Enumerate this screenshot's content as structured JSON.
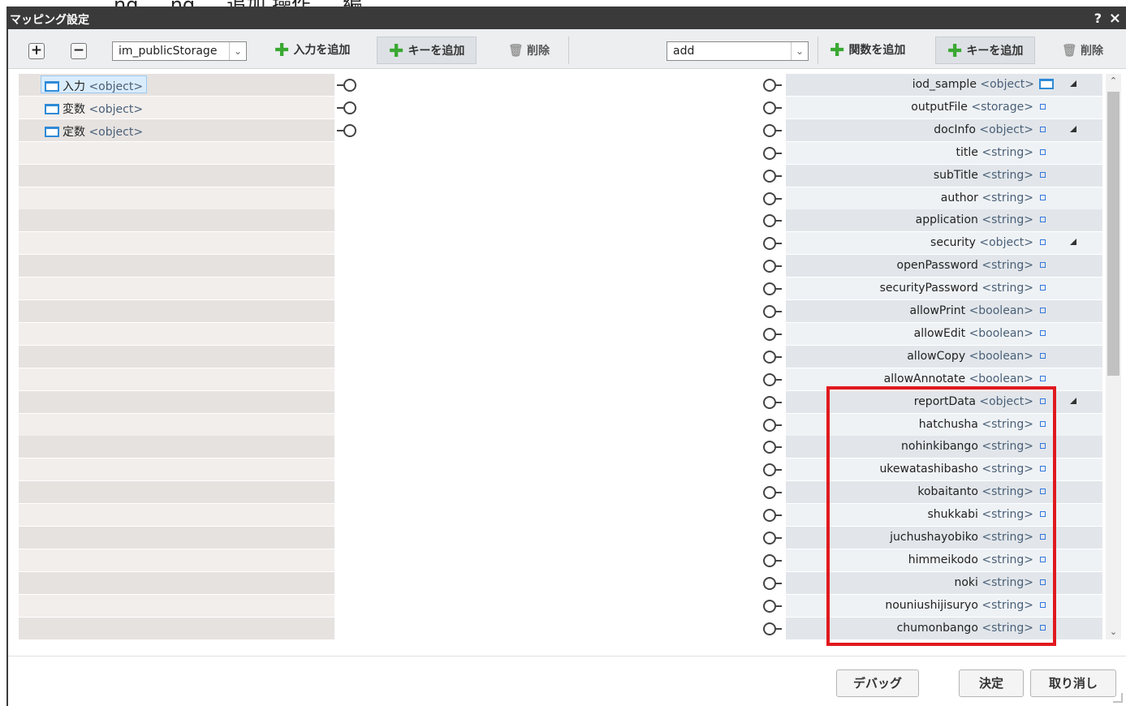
{
  "dialog": {
    "title": "マッピング設定",
    "help_label": "?",
    "close_label": "×",
    "top_strip_text": "ng … ng … 追加 操作 … 編"
  },
  "toolbar": {
    "add_label": "+",
    "remove_label": "−",
    "input_select_value": "im_publicStorage",
    "add_input_label": "入力を追加",
    "add_key_left_label": "キーを追加",
    "delete_left_label": "削除",
    "function_select_value": "add",
    "add_function_label": "関数を追加",
    "add_key_right_label": "キーを追加",
    "delete_right_label": "削除"
  },
  "left_nodes": [
    {
      "name": "入力",
      "type": "<object>"
    },
    {
      "name": "変数",
      "type": "<object>"
    },
    {
      "name": "定数",
      "type": "<object>"
    }
  ],
  "right_nodes": [
    {
      "name": "iod_sample",
      "type": "<object>",
      "expandable": true
    },
    {
      "name": "outputFile",
      "type": "<storage>",
      "expandable": false
    },
    {
      "name": "docInfo",
      "type": "<object>",
      "expandable": true
    },
    {
      "name": "title",
      "type": "<string>",
      "expandable": false
    },
    {
      "name": "subTitle",
      "type": "<string>",
      "expandable": false
    },
    {
      "name": "author",
      "type": "<string>",
      "expandable": false
    },
    {
      "name": "application",
      "type": "<string>",
      "expandable": false
    },
    {
      "name": "security",
      "type": "<object>",
      "expandable": true
    },
    {
      "name": "openPassword",
      "type": "<string>",
      "expandable": false
    },
    {
      "name": "securityPassword",
      "type": "<string>",
      "expandable": false
    },
    {
      "name": "allowPrint",
      "type": "<boolean>",
      "expandable": false
    },
    {
      "name": "allowEdit",
      "type": "<boolean>",
      "expandable": false
    },
    {
      "name": "allowCopy",
      "type": "<boolean>",
      "expandable": false
    },
    {
      "name": "allowAnnotate",
      "type": "<boolean>",
      "expandable": false
    },
    {
      "name": "reportData",
      "type": "<object>",
      "expandable": true
    },
    {
      "name": "hatchusha",
      "type": "<string>",
      "expandable": false
    },
    {
      "name": "nohinkibango",
      "type": "<string>",
      "expandable": false
    },
    {
      "name": "ukewatashibasho",
      "type": "<string>",
      "expandable": false
    },
    {
      "name": "kobaitanto",
      "type": "<string>",
      "expandable": false
    },
    {
      "name": "shukkabi",
      "type": "<string>",
      "expandable": false
    },
    {
      "name": "juchushayobiko",
      "type": "<string>",
      "expandable": false
    },
    {
      "name": "himmeikodo",
      "type": "<string>",
      "expandable": false
    },
    {
      "name": "noki",
      "type": "<string>",
      "expandable": false
    },
    {
      "name": "nouniushijisuryo",
      "type": "<string>",
      "expandable": false
    },
    {
      "name": "chumonbango",
      "type": "<string>",
      "expandable": false
    }
  ],
  "footer": {
    "debug_label": "デバッグ",
    "ok_label": "決定",
    "cancel_label": "取り消し"
  },
  "colors": {
    "highlight_box": "#e0191e",
    "add_icon": "#3aa832",
    "title_bar": "#3a3a3a"
  }
}
